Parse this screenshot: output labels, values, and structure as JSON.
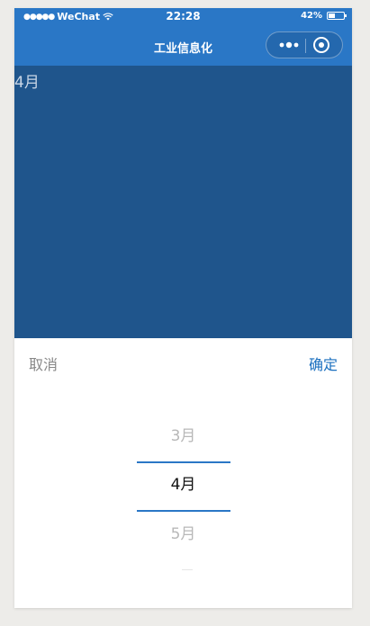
{
  "statusbar": {
    "signal_dots": "●●●●●",
    "carrier": "WeChat",
    "time": "22:28",
    "battery_text": "42%",
    "battery_level": 0.42
  },
  "navbar": {
    "title": "工业信息化",
    "more_icon": "more-dots-icon",
    "close_icon": "target-close-icon"
  },
  "content": {
    "selected_value": "4月"
  },
  "picker": {
    "cancel_label": "取消",
    "confirm_label": "确定",
    "options": [
      "3月",
      "4月",
      "5月"
    ],
    "selected_index": 1
  },
  "colors": {
    "navbar": "#2a77c6",
    "content_bg": "#1f558c",
    "accent": "#1a6fbf",
    "page_bg": "#edece9"
  }
}
